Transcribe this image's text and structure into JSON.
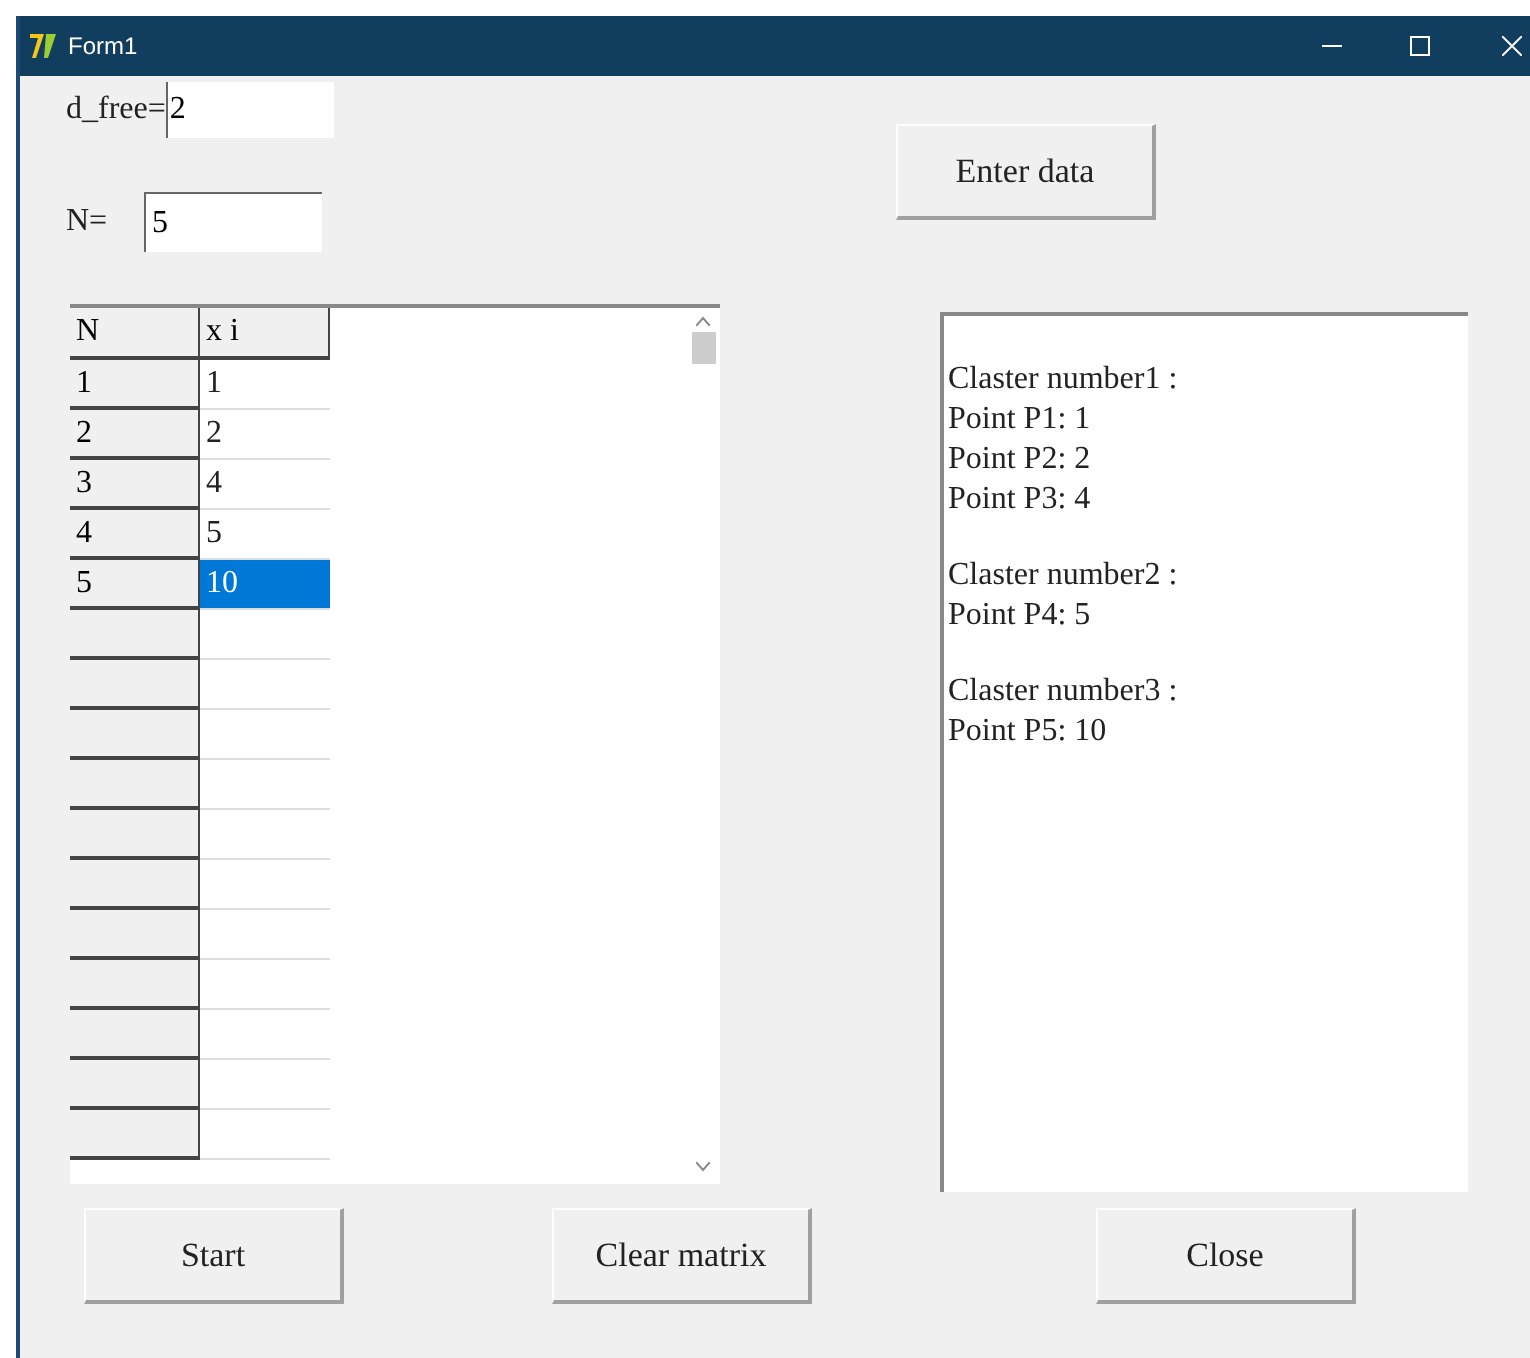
{
  "window": {
    "title": "Form1"
  },
  "fields": [
    {
      "label": "d_free=",
      "value": "2"
    },
    {
      "label": "N=",
      "value": "5"
    }
  ],
  "enter_button": "Enter data",
  "table": {
    "columns": [
      "N",
      "x i"
    ],
    "rows": [
      {
        "cells": [
          "1",
          "1"
        ],
        "selected": false
      },
      {
        "cells": [
          "2",
          "2"
        ],
        "selected": false
      },
      {
        "cells": [
          "3",
          "4"
        ],
        "selected": false
      },
      {
        "cells": [
          "4",
          "5"
        ],
        "selected": false
      },
      {
        "cells": [
          "5",
          "10"
        ],
        "selected": true
      }
    ]
  },
  "output": [
    {
      "heading": "Claster number1 :",
      "points": [
        "Point P1: 1",
        "Point P2: 2",
        "Point P3: 4"
      ]
    },
    {
      "heading": "Claster number2 :",
      "points": [
        "Point P4: 5"
      ]
    },
    {
      "heading": "Claster number3 :",
      "points": [
        "Point P5: 10"
      ]
    }
  ],
  "buttons": [
    "Start",
    "Clear matrix",
    "Close"
  ]
}
